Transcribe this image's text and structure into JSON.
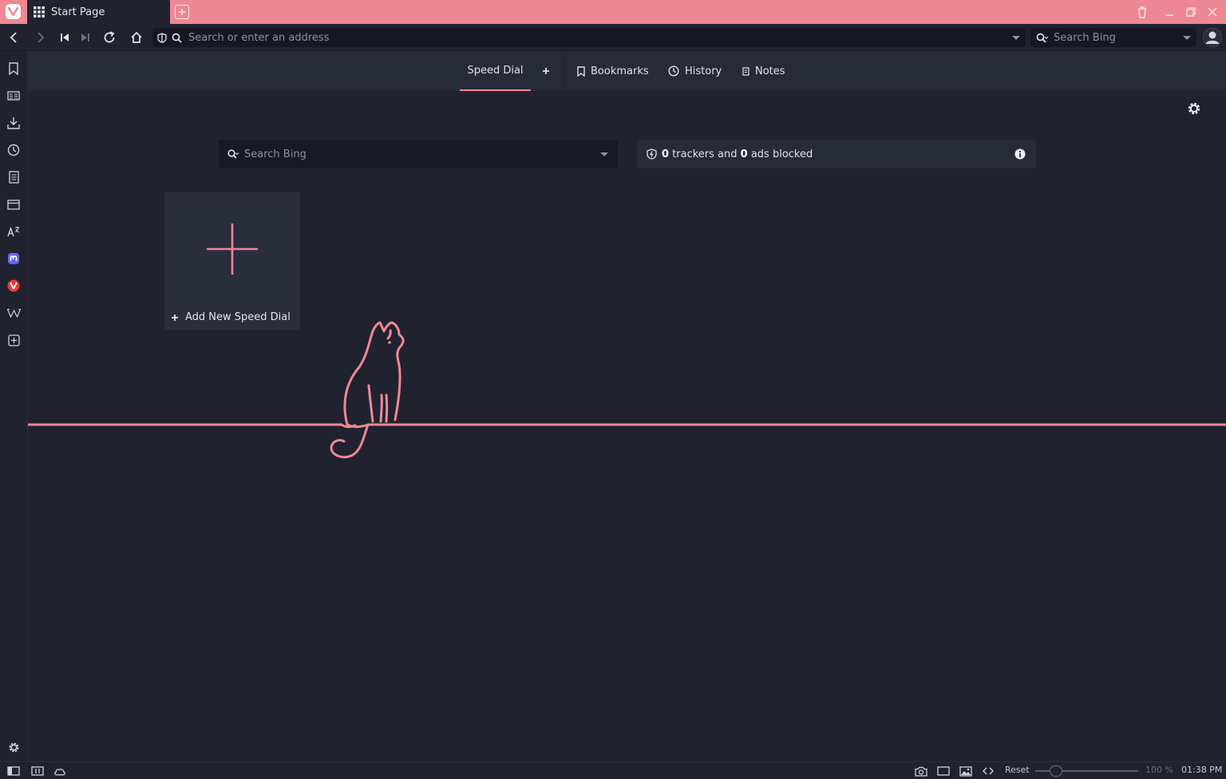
{
  "tabbar": {
    "tab_title": "Start Page",
    "accent_color": "#ee8894"
  },
  "address_bar": {
    "url_placeholder": "Search or enter an address",
    "search_placeholder": "Search Bing"
  },
  "sidebar": {
    "items": [
      "bookmarks-icon",
      "reading-list-icon",
      "downloads-icon",
      "history-icon",
      "notes-icon",
      "window-panel-icon",
      "translate-icon",
      "mastodon-icon",
      "vivaldi-icon",
      "wikipedia-icon",
      "add-panel-icon"
    ]
  },
  "start_page": {
    "tabs": {
      "speed_dial": "Speed Dial",
      "bookmarks": "Bookmarks",
      "history": "History",
      "notes": "Notes"
    },
    "search_placeholder": "Search Bing",
    "blocker": {
      "trackers": "0",
      "trackers_text": "trackers and",
      "ads": "0",
      "ads_text": "ads blocked"
    },
    "add_speed_dial_label": "Add New Speed Dial"
  },
  "statusbar": {
    "reset_label": "Reset",
    "zoom": "100 %",
    "clock": "01:38 PM"
  }
}
